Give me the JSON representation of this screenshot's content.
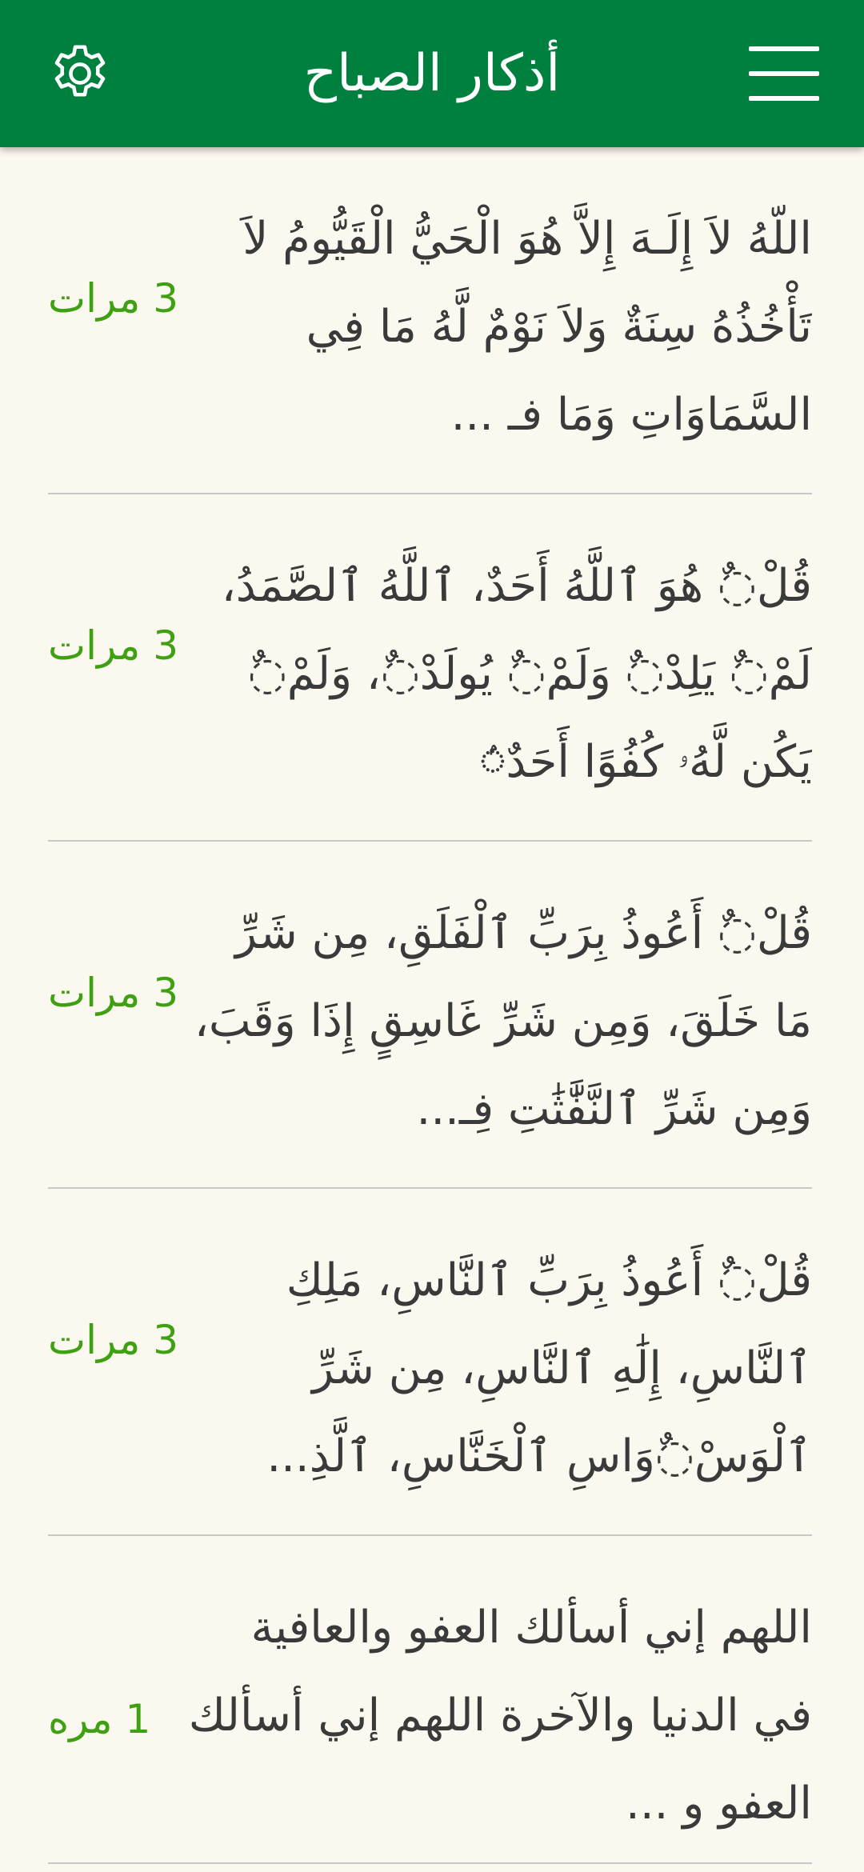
{
  "header": {
    "title": "أذكار الصباح",
    "settings_icon": "gear-icon",
    "menu_icon": "hamburger-menu-icon",
    "background_color": "#00803f"
  },
  "azkar": [
    {
      "text": "اللّهُ لاَ إِلَـهَ إِلاَّ هُوَ الْحَيُّ الْقَيُّومُ لاَ تَأْخُذُهُ سِنَةٌ وَلاَ نَوْمٌ لَّهُ مَا فِي السَّمَاوَاتِ وَمَا فـ ...",
      "count": "3 مرات"
    },
    {
      "text": "قُلْ◌ٌ هُوَ ٱللَّهُ أَحَدٌ، ٱللَّهُ ٱلصَّمَدُ، لَمْ◌ٌ يَلِدْ◌ٌ وَلَمْ◌ٌ يُولَدْ◌ٌ، وَلَمْ◌ٌ يَكُن لَّهُۥ كُفُوًا أَحَدٌ◌ۢ",
      "count": "3 مرات"
    },
    {
      "text": "قُلْ◌ٌ أَعُوذُ بِرَبِّ ٱلْفَلَقِ، مِن شَرِّ مَا خَلَقَ، وَمِن شَرِّ غَاسِقٍ إِذَا وَقَبَ، وَمِن شَرِّ ٱلنَّفَّٰثَٰتِ فِـ...",
      "count": "3 مرات"
    },
    {
      "text": "قُلْ◌ٌ أَعُوذُ بِرَبِّ ٱلنَّاسِ، مَلِكِ ٱلنَّاسِ، إِلَٰهِ ٱلنَّاسِ، مِن شَرِّ ٱلْوَسْ◌ٌوَاسِ ٱلْخَنَّاسِ، ٱلَّذِ...",
      "count": "3 مرات"
    },
    {
      "text": "اللهم إني أسألك العفو والعافية في الدنيا والآخرة اللهم إني أسألك العفو و ...",
      "count": "1 مره"
    }
  ]
}
